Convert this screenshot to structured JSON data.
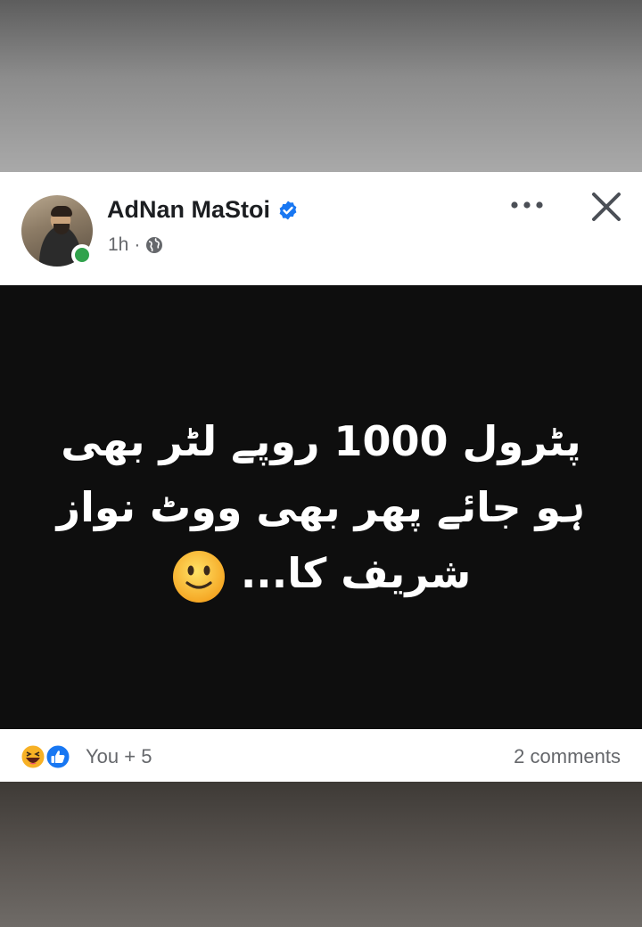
{
  "post": {
    "author_name": "AdNan MaStoi",
    "time": "1h",
    "separator": "·",
    "image_text_lines": [
      "پٹرول 1000 روپے لٹر بھی",
      "ہو جائے پھر بھی ووٹ نواز",
      "شریف کا..."
    ],
    "reactions_label": "You + 5",
    "comments_label": "2 comments"
  },
  "icons": {
    "verified": "verified-badge-icon",
    "audience": "globe-icon",
    "more": "more-dots-icon",
    "close": "close-icon",
    "emoji": "slightly-smiling-face-emoji",
    "reactions": [
      "haha-reaction-icon",
      "like-reaction-icon"
    ]
  },
  "colors": {
    "verified_blue": "#1877f2",
    "online_green": "#31a24c",
    "meta_gray": "#65676b",
    "image_background": "#0e0e0e",
    "like_blue": "#1877f2",
    "haha_yellow": "#f7b125"
  }
}
